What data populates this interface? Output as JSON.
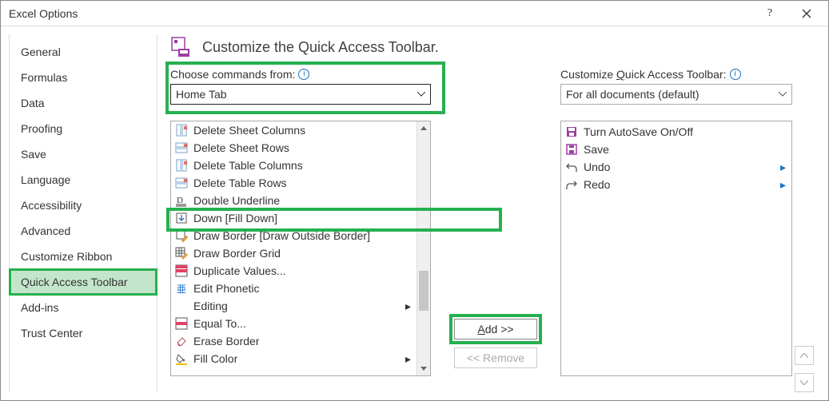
{
  "window": {
    "title": "Excel Options"
  },
  "sidebar": {
    "items": [
      {
        "label": "General"
      },
      {
        "label": "Formulas"
      },
      {
        "label": "Data"
      },
      {
        "label": "Proofing"
      },
      {
        "label": "Save"
      },
      {
        "label": "Language"
      },
      {
        "label": "Accessibility"
      },
      {
        "label": "Advanced"
      },
      {
        "label": "Customize Ribbon"
      },
      {
        "label": "Quick Access Toolbar"
      },
      {
        "label": "Add-ins"
      },
      {
        "label": "Trust Center"
      }
    ],
    "selected_index": 9
  },
  "header": {
    "title": "Customize the Quick Access Toolbar."
  },
  "left": {
    "label_prefix": "Choose commands from:",
    "select_value": "Home Tab",
    "commands": [
      {
        "label": "Delete Sheet Columns",
        "icon": "delete-col"
      },
      {
        "label": "Delete Sheet Rows",
        "icon": "delete-row"
      },
      {
        "label": "Delete Table Columns",
        "icon": "delete-col"
      },
      {
        "label": "Delete Table Rows",
        "icon": "delete-row"
      },
      {
        "label": "Double Underline",
        "icon": "double-underline"
      },
      {
        "label": "Down [Fill Down]",
        "icon": "fill-down"
      },
      {
        "label": "Draw Border [Draw Outside Border]",
        "icon": "pencil-border"
      },
      {
        "label": "Draw Border Grid",
        "icon": "pencil-grid"
      },
      {
        "label": "Duplicate Values...",
        "icon": "dup-values"
      },
      {
        "label": "Edit Phonetic",
        "icon": "edit-phonetic"
      },
      {
        "label": "Editing",
        "icon": "none",
        "submenu": true
      },
      {
        "label": "Equal To...",
        "icon": "equal-to"
      },
      {
        "label": "Erase Border",
        "icon": "erase-border"
      },
      {
        "label": "Fill Color",
        "icon": "fill-color",
        "submenu": true
      }
    ]
  },
  "right": {
    "label_prefix": "Customize ",
    "label_underlined": "Q",
    "label_suffix": "uick Access Toolbar:",
    "select_value": "For all documents (default)",
    "commands": [
      {
        "label": "Turn AutoSave On/Off",
        "icon": "autosave"
      },
      {
        "label": "Save",
        "icon": "save"
      },
      {
        "label": "Undo",
        "icon": "undo",
        "submenu": true
      },
      {
        "label": "Redo",
        "icon": "redo",
        "submenu": true
      }
    ]
  },
  "buttons": {
    "add_underlined": "A",
    "add_suffix": "dd >>",
    "remove": "<< Remove"
  }
}
